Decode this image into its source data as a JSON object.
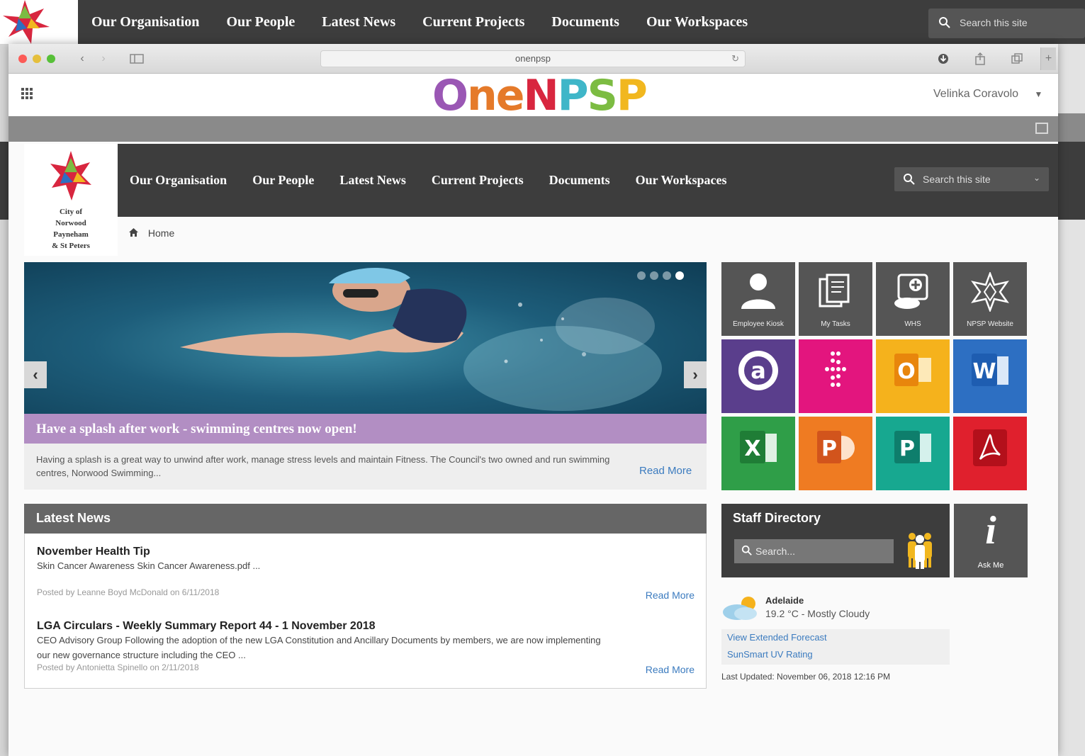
{
  "background_page": {
    "nav": [
      "Our Organisation",
      "Our People",
      "Latest News",
      "Current Projects",
      "Documents",
      "Our Workspaces"
    ],
    "search_placeholder": "Search this site"
  },
  "browser": {
    "url": "onenpsp"
  },
  "suite_bar": {
    "brand": "OneNPSP",
    "brand_letters": [
      {
        "ch": "O",
        "color": "#9a57b4"
      },
      {
        "ch": "n",
        "color": "#e57a2a"
      },
      {
        "ch": "e",
        "color": "#e57a2a"
      },
      {
        "ch": "N",
        "color": "#d8263f"
      },
      {
        "ch": "P",
        "color": "#3fb6c8"
      },
      {
        "ch": "S",
        "color": "#7cbc42"
      },
      {
        "ch": "P",
        "color": "#f1b71f"
      }
    ],
    "user_name": "Velinka Coravolo"
  },
  "site": {
    "logo_text": "City of\nNorwood\nPayneham\n& St Peters",
    "nav": [
      "Our Organisation",
      "Our People",
      "Latest News",
      "Current Projects",
      "Documents",
      "Our Workspaces"
    ],
    "search_placeholder": "Search this site",
    "breadcrumb": "Home"
  },
  "carousel": {
    "title": "Have a splash after work - swimming centres now open!",
    "body": "Having a splash is a great way to unwind after work, manage stress levels and maintain Fitness. The Council's two owned and run swimming centres, Norwood Swimming...",
    "read_more": "Read More",
    "slide_count": 4,
    "active_slide": 4
  },
  "tiles": [
    {
      "name": "employee-kiosk",
      "label": "Employee Kiosk",
      "bg": "#555555",
      "icon": "person-icon"
    },
    {
      "name": "my-tasks",
      "label": "My Tasks",
      "bg": "#555555",
      "icon": "documents-icon"
    },
    {
      "name": "whs",
      "label": "WHS",
      "bg": "#555555",
      "icon": "first-aid-icon"
    },
    {
      "name": "npsp-website",
      "label": "NPSP Website",
      "bg": "#555555",
      "icon": "star-outline-icon"
    },
    {
      "name": "app-a",
      "label": "",
      "bg": "#5a3e8c",
      "icon": "a-logo-icon"
    },
    {
      "name": "app-dots",
      "label": "",
      "bg": "#e3157e",
      "icon": "dots-logo-icon"
    },
    {
      "name": "outlook",
      "label": "",
      "bg": "#f5b21c",
      "icon": "outlook-icon"
    },
    {
      "name": "word",
      "label": "",
      "bg": "#2d6fc2",
      "icon": "word-icon"
    },
    {
      "name": "excel",
      "label": "",
      "bg": "#2f9e48",
      "icon": "excel-icon"
    },
    {
      "name": "powerpoint",
      "label": "",
      "bg": "#ef7b22",
      "icon": "powerpoint-icon"
    },
    {
      "name": "publisher",
      "label": "",
      "bg": "#17a890",
      "icon": "publisher-icon"
    },
    {
      "name": "acrobat",
      "label": "",
      "bg": "#e0202d",
      "icon": "acrobat-icon"
    }
  ],
  "news": {
    "heading": "Latest News",
    "items": [
      {
        "title": "November Health Tip",
        "desc": "Skin Cancer Awareness Skin Cancer Awareness.pdf ...",
        "meta": "Posted by Leanne Boyd McDonald on 6/11/2018",
        "read_more": "Read More"
      },
      {
        "title": "LGA Circulars - Weekly Summary Report 44 - 1 November 2018",
        "desc": "CEO Advisory Group Following the adoption of the new LGA Constitution and Ancillary Documents by members, we are now implementing our new governance structure including the CEO ...",
        "meta": "Posted by Antonietta Spinello on 2/11/2018",
        "read_more": "Read More"
      }
    ]
  },
  "staff_directory": {
    "heading": "Staff Directory",
    "search_placeholder": "Search..."
  },
  "ask_me": {
    "label": "Ask Me"
  },
  "weather": {
    "city": "Adelaide",
    "conditions": "19.2 °C - Mostly Cloudy",
    "links": [
      "View Extended Forecast",
      "SunSmart UV Rating"
    ],
    "updated": "Last Updated: November 06, 2018 12:16 PM"
  }
}
